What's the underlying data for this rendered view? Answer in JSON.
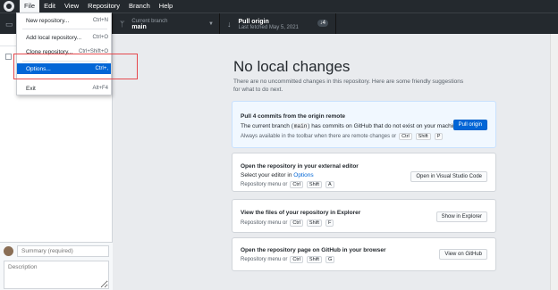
{
  "menubar": {
    "items": [
      "File",
      "Edit",
      "View",
      "Repository",
      "Branch",
      "Help"
    ]
  },
  "toolbar": {
    "branch_caption": "Current branch",
    "branch_name": "main",
    "pull_title": "Pull origin",
    "pull_subtitle": "Last fetched May 5, 2021",
    "pull_count": "4"
  },
  "file_menu": {
    "items": [
      {
        "label": "New repository...",
        "shortcut": "Ctrl+N"
      },
      {
        "label": "Add local repository...",
        "shortcut": "Ctrl+O"
      },
      {
        "label": "Clone repository...",
        "shortcut": "Ctrl+Shift+O"
      },
      {
        "label": "Options...",
        "shortcut": "Ctrl+,"
      },
      {
        "label": "Exit",
        "shortcut": "Alt+F4"
      }
    ]
  },
  "commit": {
    "summary_placeholder": "Summary (required)",
    "description_placeholder": "Description"
  },
  "main": {
    "title": "No local changes",
    "description": "There are no uncommitted changes in this repository. Here are some friendly suggestions for what to do next.",
    "pull_card": {
      "title": "Pull 4 commits from the origin remote",
      "line_prefix": "The current branch (",
      "branch": "main",
      "line_suffix": ") has commits on GitHub that do not exist on your machine.",
      "hint": "Always available in the toolbar when there are remote changes or",
      "keys": [
        "Ctrl",
        "Shift",
        "P"
      ],
      "button": "Pull origin"
    },
    "editor_card": {
      "title": "Open the repository in your external editor",
      "line_prefix": "Select your editor in",
      "link": "Options",
      "hint": "Repository menu or",
      "keys": [
        "Ctrl",
        "Shift",
        "A"
      ],
      "button": "Open in Visual Studio Code"
    },
    "explorer_card": {
      "title": "View the files of your repository in Explorer",
      "hint": "Repository menu or",
      "keys": [
        "Ctrl",
        "Shift",
        "F"
      ],
      "button": "Show in Explorer"
    },
    "github_card": {
      "title": "Open the repository page on GitHub in your browser",
      "hint": "Repository menu or",
      "keys": [
        "Ctrl",
        "Shift",
        "G"
      ],
      "button": "View on GitHub"
    }
  },
  "colors": {
    "accent": "#0366d6",
    "highlight": "#e5484d",
    "titlebar": "#24292e"
  }
}
